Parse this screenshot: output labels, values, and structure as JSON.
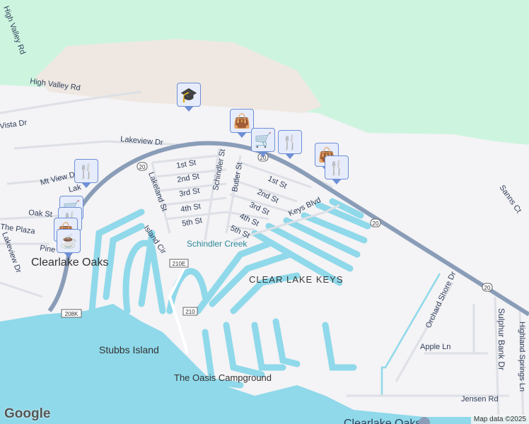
{
  "map": {
    "colors": {
      "forest": "#cdf4df",
      "sand": "#efe8e2",
      "land": "#f4f3f5",
      "water": "#8fd9ea",
      "highway": "#8a9db8",
      "road": "#dde0e6"
    },
    "places": {
      "town": "Clearlake Oaks",
      "area": "CLEAR LAKE KEYS",
      "creek": "Schindler Creek",
      "island": "Stubbs Island",
      "campground": "The Oasis Campground",
      "bottom_town": "Clearlake Oaks"
    },
    "streets": {
      "high_valley_1": "High Valley Rd",
      "high_valley_2": "High Valley Rd",
      "vista": "Vista Dr",
      "lakeview": "Lakeview Dr",
      "mt_view": "Mt View Dr",
      "lak": "Lak",
      "oak": "Oak St",
      "plaza": "The Plaza",
      "pine": "Pine",
      "lakeview_dr_v": "Lakeview Dr",
      "first_w": "1st St",
      "second_w": "2nd St",
      "third_w": "3rd St",
      "fourth_w": "4th St",
      "fifth_w": "5th St",
      "lakeland": "Lakeland St",
      "schindler": "Schindler St",
      "butler": "Butler St",
      "island_cir": "Island Cir",
      "first_e": "1st St",
      "second_e": "2nd St",
      "third_e": "3rd St",
      "fourth_e": "4th St",
      "fifth_e": "5th St",
      "keys": "Keys Blvd",
      "sanns": "Sanns Ct",
      "orchard": "Orchard Shore Dr",
      "apple": "Apple Ln",
      "sulphur": "Sulphur Bank Dr",
      "highland": "Highland Springs Ln",
      "jensen": "Jensen Rd"
    },
    "shields": {
      "r20a": "20",
      "r20b": "20",
      "r20c": "20",
      "r20d": "20",
      "r210e": "210E",
      "r210": "210",
      "r208k": "208K"
    },
    "pois": [
      {
        "icon": "school-icon",
        "glyph": "🎓"
      },
      {
        "icon": "shopping-bag-icon",
        "glyph": "👜"
      },
      {
        "icon": "shopping-cart-icon",
        "glyph": "🛒"
      },
      {
        "icon": "restaurant-icon",
        "glyph": "🍴"
      },
      {
        "icon": "shopping-bag-icon",
        "glyph": "👜"
      },
      {
        "icon": "restaurant-icon",
        "glyph": "🍴"
      },
      {
        "icon": "restaurant-icon",
        "glyph": "🍴"
      },
      {
        "icon": "shopping-cart-icon",
        "glyph": "🛒"
      },
      {
        "icon": "restaurant-icon",
        "glyph": "🍴"
      },
      {
        "icon": "shopping-bag-icon",
        "glyph": "👜"
      },
      {
        "icon": "cafe-icon",
        "glyph": "☕"
      }
    ],
    "logo": "Google",
    "attribution": "Map data ©2025"
  }
}
